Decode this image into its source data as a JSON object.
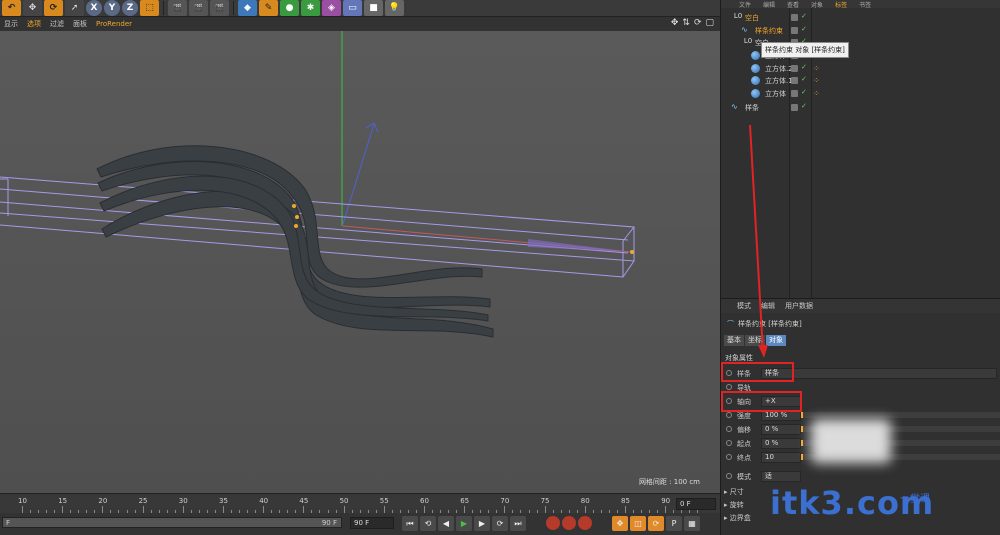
{
  "toolbar": {
    "buttons": [
      {
        "icon": "x-axis-icon",
        "label": "X"
      },
      {
        "icon": "y-axis-icon",
        "label": "Y"
      },
      {
        "icon": "z-axis-icon",
        "label": "Z"
      }
    ]
  },
  "viewport_menu": {
    "items": [
      "显示",
      "选项",
      "过滤",
      "面板",
      "ProRender"
    ],
    "active_index": 1,
    "grid_info": "网格间距 : 100 cm"
  },
  "timeline": {
    "ticks": [
      "10",
      "15",
      "20",
      "25",
      "30",
      "35",
      "40",
      "45",
      "50",
      "55",
      "60",
      "65",
      "70",
      "75",
      "80",
      "85",
      "90"
    ],
    "current_frame": "0 F",
    "range_start": "F",
    "range_end": "90 F",
    "end_frame": "90 F"
  },
  "object_manager": {
    "menu": [
      "文件",
      "编辑",
      "查看",
      "对象",
      "标签",
      "书签"
    ],
    "rows": [
      {
        "name": "空白",
        "depth": 0,
        "type": "null",
        "highlight": true
      },
      {
        "name": "样条约束",
        "depth": 1,
        "type": "spline",
        "highlight": true
      },
      {
        "name": "空白",
        "depth": 1,
        "type": "null",
        "highlight": false
      },
      {
        "name": "立方体",
        "depth": 2,
        "type": "sphere",
        "highlight": false
      },
      {
        "name": "立方体.2",
        "depth": 2,
        "type": "sphere",
        "highlight": false
      },
      {
        "name": "立方体.1",
        "depth": 2,
        "type": "sphere",
        "highlight": false
      },
      {
        "name": "立方体",
        "depth": 2,
        "type": "sphere",
        "highlight": false
      },
      {
        "name": "样条",
        "depth": 0,
        "type": "spline",
        "highlight": false
      }
    ],
    "tooltip": "样条约束 对象 [样条约束]"
  },
  "attribute_manager": {
    "menu": [
      "模式",
      "编辑",
      "用户数据"
    ],
    "title": "样条约束 [样条约束]",
    "tabs": [
      "基本",
      "坐标",
      "对象"
    ],
    "active_tab": 2,
    "section": "对象属性",
    "fields": [
      {
        "label": "样条",
        "value": "样条"
      },
      {
        "label": "导轨",
        "value": ""
      },
      {
        "label": "轴向",
        "value": "+X"
      },
      {
        "label": "强度",
        "value": "100 %"
      },
      {
        "label": "偏移",
        "value": "0 %"
      },
      {
        "label": "起点",
        "value": "0 %"
      },
      {
        "label": "终点",
        "value": "10"
      },
      {
        "label": "模式",
        "value": "适"
      }
    ],
    "groups": [
      "尺寸",
      "旋转",
      "边界盒"
    ]
  },
  "watermark": {
    "text": "itk3.com",
    "sub": "一堂课"
  },
  "colors": {
    "accent": "#f1a82a",
    "annotation": "#e02323",
    "watermark": "#3b6fd0"
  }
}
